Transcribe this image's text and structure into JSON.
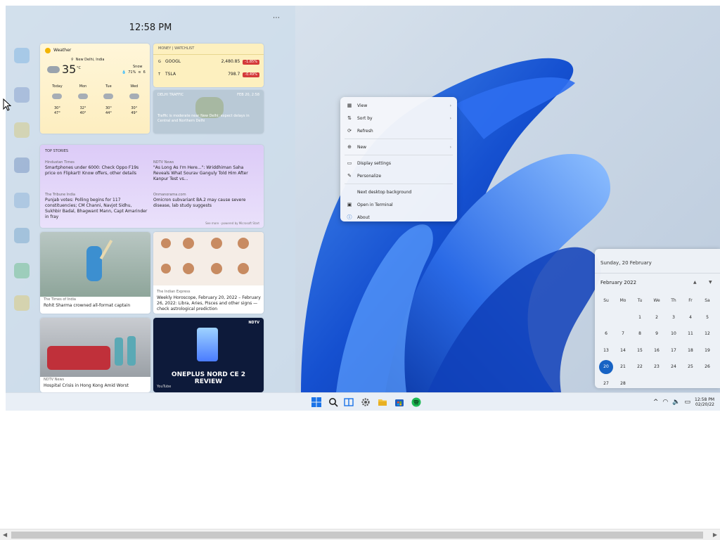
{
  "widgets": {
    "time": "12:58 PM",
    "more": "⋯",
    "weather": {
      "title": "Weather",
      "location": "New Delhi, India",
      "temp": "35",
      "unit": "°C",
      "condition": "Snow",
      "humidity": "71%",
      "wind": "6",
      "forecast": [
        {
          "day": "Today",
          "high": "30°",
          "low": "47°"
        },
        {
          "day": "Mon",
          "high": "32°",
          "low": "40°"
        },
        {
          "day": "Tue",
          "high": "30°",
          "low": "44°"
        },
        {
          "day": "Wed",
          "high": "30°",
          "low": "49°"
        }
      ]
    },
    "money": {
      "header": "MONEY | WATCHLIST",
      "stocks": [
        {
          "symbol": "GOOGL",
          "price": "2,480.85",
          "change": "-1.85%"
        },
        {
          "symbol": "TSLA",
          "price": "798.7",
          "change": "-0.49%"
        }
      ]
    },
    "traffic": {
      "header_left": "DELHI TRAFFIC",
      "header_right": "FEB 20, 2:58",
      "text": "Traffic is moderate near New Delhi; expect delays in Central and Northern Delhi"
    },
    "stories": {
      "header": "TOP STORIES",
      "items": [
        {
          "source": "Hindustan Times",
          "headline": "Smartphones under 6000: Check Oppo F19s price on Flipkart! Know offers, other details"
        },
        {
          "source": "NDTV News",
          "headline": "\"As Long As I'm Here...\": Wriddhiman Saha Reveals What Sourav Ganguly Told Him After Kanpur Test vs..."
        },
        {
          "source": "The Tribune India",
          "headline": "Punjab votes: Polling begins for 117 constituencies; CM Channi, Navjot Sidhu, Sukhbir Badal, Bhagwant Mann, Capt Amarinder in fray"
        },
        {
          "source": "Onmanorama.com",
          "headline": "Omicron subvariant BA.2 may cause severe disease, lab study suggests"
        }
      ],
      "footer": "See more · powered by Microsoft Start"
    },
    "cricket": {
      "source": "The Times of India",
      "headline": "Rohit Sharma crowned all-format captain"
    },
    "horoscope": {
      "source": "The Indian Express",
      "headline": "Weekly Horoscope, February 20, 2022 – February 26, 2022: Libra, Aries, Pisces and other signs — check astrological prediction"
    },
    "hongkong": {
      "source": "NDTV News",
      "headline": "Hospital Crisis in Hong Kong Amid Worst"
    },
    "oneplus": {
      "source": "YouTube",
      "brand": "NDTV",
      "headline_line1": "ONEPLUS NORD CE 2",
      "headline_line2": "REVIEW"
    }
  },
  "context_menu": {
    "items": [
      {
        "icon": "▦",
        "label": "View",
        "arrow": "›"
      },
      {
        "icon": "⇅",
        "label": "Sort by",
        "arrow": "›"
      },
      {
        "icon": "⟳",
        "label": "Refresh",
        "arrow": ""
      },
      {
        "icon": "⊕",
        "label": "New",
        "arrow": "›"
      },
      {
        "icon": "▭",
        "label": "Display settings",
        "arrow": ""
      },
      {
        "icon": "✎",
        "label": "Personalize",
        "arrow": ""
      },
      {
        "icon": "",
        "label": "Next desktop background",
        "arrow": ""
      },
      {
        "icon": "▣",
        "label": "Open in Terminal",
        "arrow": ""
      },
      {
        "icon": "ⓘ",
        "label": "About",
        "arrow": ""
      }
    ]
  },
  "calendar": {
    "full_date": "Sunday, 20 February",
    "month": "February 2022",
    "up": "▲",
    "down": "▼",
    "weekdays": [
      "Su",
      "Mo",
      "Tu",
      "We",
      "Th",
      "Fr",
      "Sa"
    ],
    "days": [
      "",
      "",
      "1",
      "2",
      "3",
      "4",
      "5",
      "6",
      "7",
      "8",
      "9",
      "10",
      "11",
      "12",
      "13",
      "14",
      "15",
      "16",
      "17",
      "18",
      "19",
      "20",
      "21",
      "22",
      "23",
      "24",
      "25",
      "26",
      "27",
      "28"
    ],
    "today": "20"
  },
  "taskbar": {
    "tray_chevron": "^",
    "wifi": "◠",
    "volume": "🔈",
    "battery": "▭",
    "time": "12:58 PM",
    "date": "02/20/22"
  },
  "scrollbar": {
    "left": "◀",
    "right": "▶"
  }
}
